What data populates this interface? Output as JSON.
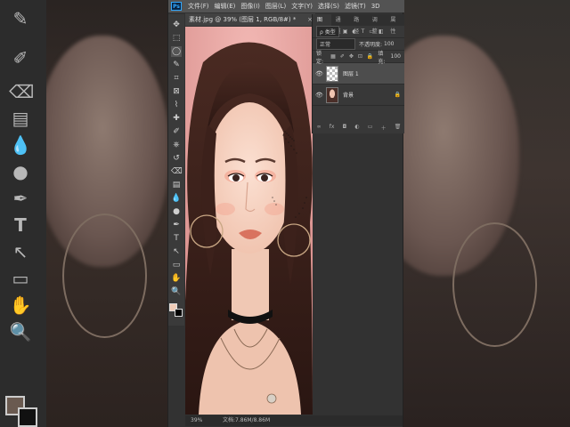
{
  "menubar": {
    "logo": "Ps",
    "items": [
      "文件(F)",
      "编辑(E)",
      "图像(I)",
      "图层(L)",
      "文字(Y)",
      "选择(S)",
      "滤镜(T)",
      "3D"
    ]
  },
  "document": {
    "tab_title": "素材.jpg @ 39% (图层 1, RGB/8#) *",
    "close_glyph": "×"
  },
  "status": {
    "zoom": "39%",
    "doc_info": "文档:7.86M/8.86M"
  },
  "layers_panel": {
    "tabs": [
      "图层",
      "通道",
      "路径",
      "调整",
      "属性"
    ],
    "filter_label": "ρ 类型",
    "blend_mode": "正常",
    "opacity_label": "不透明度:",
    "opacity_value": "100",
    "lock_label": "锁定:",
    "fill_label": "填充:",
    "fill_value": "100",
    "layers": [
      {
        "name": "图层 1",
        "selected": true
      },
      {
        "name": "背景",
        "selected": false
      }
    ],
    "footer_icons": [
      "link-icon",
      "fx-icon",
      "mask-icon",
      "adjustment-icon",
      "group-icon",
      "new-layer-icon",
      "trash-icon"
    ],
    "footer_glyphs": [
      "∞",
      "fx",
      "◘",
      "◐",
      "▭",
      "＋",
      "🗑"
    ]
  },
  "tools": {
    "names": [
      "move-tool-icon",
      "marquee-tool-icon",
      "lasso-tool-icon",
      "quick-select-tool-icon",
      "crop-tool-icon",
      "frame-tool-icon",
      "eyedropper-tool-icon",
      "healing-tool-icon",
      "brush-tool-icon",
      "stamp-tool-icon",
      "history-brush-icon",
      "eraser-tool-icon",
      "gradient-tool-icon",
      "blur-tool-icon",
      "dodge-tool-icon",
      "pen-tool-icon",
      "type-tool-icon",
      "path-select-icon",
      "shape-tool-icon",
      "hand-tool-icon",
      "zoom-tool-icon"
    ],
    "glyphs": [
      "✥",
      "⬚",
      "◯",
      "✎",
      "⌗",
      "⊠",
      "⌇",
      "✚",
      "✐",
      "⎈",
      "↺",
      "⌫",
      "▤",
      "💧",
      "●",
      "✒",
      "T",
      "↖",
      "▭",
      "✋",
      "🔍"
    ]
  },
  "colors": {
    "foreground": "#f1cdb8",
    "background": "#000000",
    "accent": "#31a8ff"
  }
}
